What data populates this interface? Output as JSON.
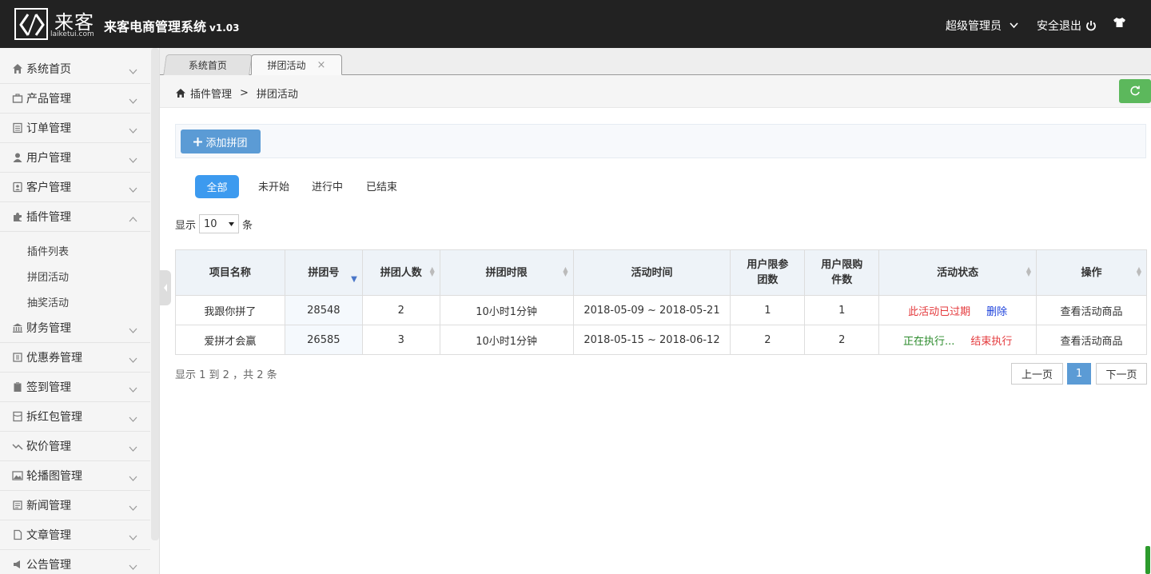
{
  "header": {
    "logo_cn": "来客",
    "logo_en": "laiketui.com",
    "system_title": "来客电商管理系统",
    "version": "v1.03",
    "admin_label": "超级管理员",
    "logout_label": "安全退出"
  },
  "sidebar": {
    "items": [
      {
        "label": "系统首页",
        "icon": "home-icon"
      },
      {
        "label": "产品管理",
        "icon": "briefcase-icon"
      },
      {
        "label": "订单管理",
        "icon": "list-icon"
      },
      {
        "label": "用户管理",
        "icon": "user-icon"
      },
      {
        "label": "客户管理",
        "icon": "contact-icon"
      },
      {
        "label": "插件管理",
        "icon": "puzzle-icon",
        "expanded": true
      },
      {
        "label": "财务管理",
        "icon": "bank-icon"
      },
      {
        "label": "优惠券管理",
        "icon": "coupon-icon"
      },
      {
        "label": "签到管理",
        "icon": "clipboard-icon"
      },
      {
        "label": "拆红包管理",
        "icon": "redpacket-icon"
      },
      {
        "label": "砍价管理",
        "icon": "trend-icon"
      },
      {
        "label": "轮播图管理",
        "icon": "image-icon"
      },
      {
        "label": "新闻管理",
        "icon": "news-icon"
      },
      {
        "label": "文章管理",
        "icon": "file-icon"
      },
      {
        "label": "公告管理",
        "icon": "megaphone-icon"
      }
    ],
    "sub_items": [
      "插件列表",
      "拼团活动",
      "抽奖活动"
    ]
  },
  "tabs": {
    "home": "系统首页",
    "active": "拼团活动",
    "close": "×"
  },
  "breadcrumb": {
    "parent": "插件管理",
    "separator": ">",
    "current": "拼团活动"
  },
  "toolbar": {
    "add_label": "添加拼团"
  },
  "filters": [
    "全部",
    "未开始",
    "进行中",
    "已结束"
  ],
  "length": {
    "prefix": "显示",
    "value": "10",
    "suffix": "条"
  },
  "table": {
    "headers": [
      "项目名称",
      "拼团号",
      "拼团人数",
      "拼团时限",
      "活动时间",
      "用户限参团数",
      "用户限购件数",
      "活动状态",
      "操作"
    ],
    "rows": [
      {
        "name": "我跟你拼了",
        "group_no": "28548",
        "people": "2",
        "limit": "10小时1分钟",
        "time": "2018-05-09 ~ 2018-05-21",
        "join_limit": "1",
        "buy_limit": "1",
        "status": "此活动已过期",
        "status_action": "删除",
        "op": "查看活动商品"
      },
      {
        "name": "爱拼才会赢",
        "group_no": "26585",
        "people": "3",
        "limit": "10小时1分钟",
        "time": "2018-05-15 ~ 2018-06-12",
        "join_limit": "2",
        "buy_limit": "2",
        "status": "正在执行...",
        "status_action": "结束执行",
        "op": "查看活动商品"
      }
    ]
  },
  "info": "显示 1 到 2 ，共 2 条",
  "pagination": {
    "prev": "上一页",
    "current": "1",
    "next": "下一页"
  },
  "colors": {
    "header_bg": "#222222",
    "primary": "#5b9bd5",
    "filter_active": "#3c9aef",
    "refresh": "#5cb85c",
    "expired": "#e4393c",
    "running": "#2a8a2a",
    "delete": "#1a3fdb"
  }
}
